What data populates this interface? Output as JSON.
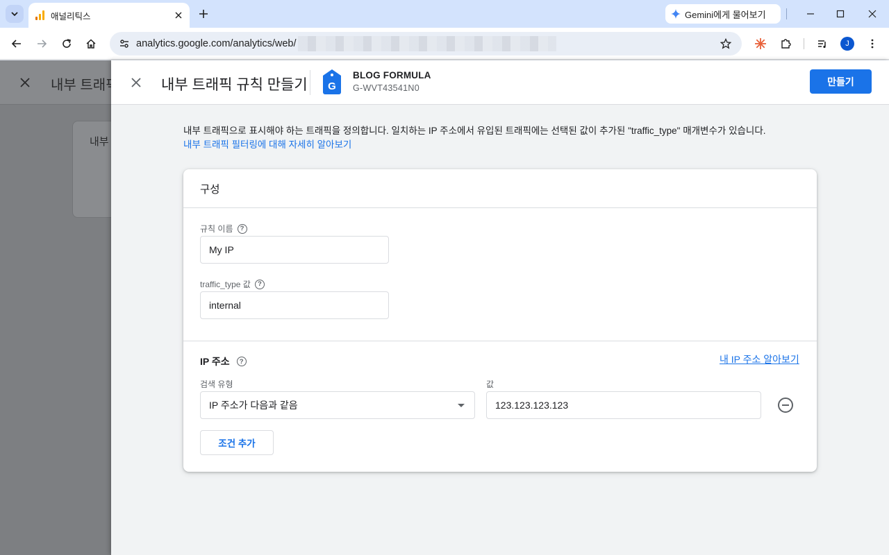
{
  "browser": {
    "tab_title": "애널리틱스",
    "gemini_label": "Gemini에게 물어보기",
    "url": "analytics.google.com/analytics/web/",
    "avatar_initial": "J"
  },
  "background_page": {
    "title": "내부 트래픽",
    "card_text": "내부"
  },
  "panel": {
    "title": "내부 트래픽 규칙 만들기",
    "property_name": "BLOG FORMULA",
    "property_id": "G-WVT43541N0",
    "create_button": "만들기",
    "description": "내부 트래픽으로 표시해야 하는 트래픽을 정의합니다. 일치하는 IP 주소에서 유입된 트래픽에는 선택된 값이 추가된 \"traffic_type\" 매개변수가 있습니다.",
    "learn_more_link": "내부 트래픽 필터링에 대해 자세히 알아보기"
  },
  "config": {
    "title": "구성",
    "rule_name_label": "규칙 이름",
    "rule_name_value": "My IP",
    "traffic_type_label": "traffic_type 값",
    "traffic_type_value": "internal",
    "ip_section_title": "IP 주소",
    "my_ip_link": "내 IP 주소 알아보기",
    "match_type_label": "검색 유형",
    "match_type_value": "IP 주소가 다음과 같음",
    "value_label": "값",
    "ip_value": "123.123.123.123",
    "add_condition_button": "조건 추가"
  },
  "colors": {
    "accent": "#1a73e8",
    "tabstrip": "#d3e3fd",
    "analytics_orange": "#f9ab00"
  }
}
